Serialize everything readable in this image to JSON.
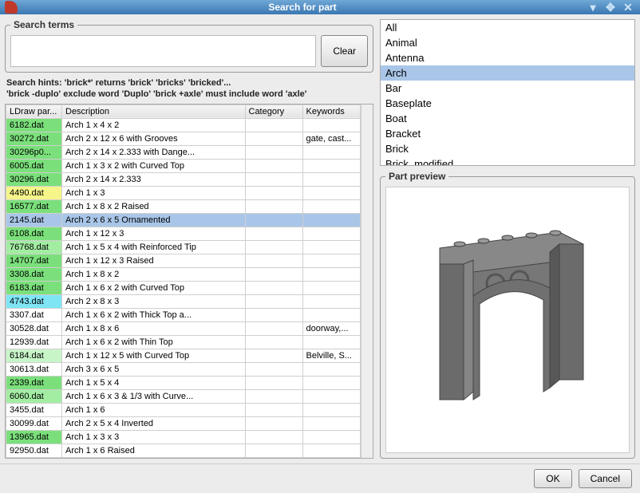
{
  "window": {
    "title": "Search for part"
  },
  "search": {
    "legend": "Search terms",
    "value": "",
    "clear": "Clear"
  },
  "hints": {
    "line1": "Search hints: 'brick*' returns 'brick' 'bricks' 'bricked'...",
    "line2": "'brick -duplo' exclude word 'Duplo' 'brick +axle' must include word 'axle'"
  },
  "table": {
    "headers": [
      "LDraw par...",
      "Description",
      "Category",
      "Keywords"
    ],
    "rows": [
      {
        "f": "6182.dat",
        "d": "Arch  1 x  4 x  2",
        "c": "",
        "k": "",
        "cls": "g1"
      },
      {
        "f": "30272.dat",
        "d": "Arch  2 x 12 x  6 with Grooves",
        "c": "",
        "k": "gate, cast...",
        "cls": "g1"
      },
      {
        "f": "30296p0...",
        "d": "Arch  2 x 14 x  2.333 with Dange...",
        "c": "",
        "k": "",
        "cls": "g1"
      },
      {
        "f": "6005.dat",
        "d": "Arch  1 x  3 x  2 with Curved Top",
        "c": "",
        "k": "",
        "cls": "g1"
      },
      {
        "f": "30296.dat",
        "d": "Arch  2 x 14 x  2.333",
        "c": "",
        "k": "",
        "cls": "g1"
      },
      {
        "f": "4490.dat",
        "d": "Arch  1 x  3",
        "c": "",
        "k": "",
        "cls": "y"
      },
      {
        "f": "16577.dat",
        "d": "Arch  1 x  8 x  2 Raised",
        "c": "",
        "k": "",
        "cls": "g1"
      },
      {
        "f": "2145.dat",
        "d": "Arch  2 x  6 x  5 Ornamented",
        "c": "",
        "k": "",
        "cls": "y",
        "sel": true
      },
      {
        "f": "6108.dat",
        "d": "Arch  1 x 12 x  3",
        "c": "",
        "k": "",
        "cls": "g1"
      },
      {
        "f": "76768.dat",
        "d": "Arch  1 x  5 x  4 with Reinforced Tip",
        "c": "",
        "k": "",
        "cls": "g2"
      },
      {
        "f": "14707.dat",
        "d": "Arch  1 x 12 x  3 Raised",
        "c": "",
        "k": "",
        "cls": "g1"
      },
      {
        "f": "3308.dat",
        "d": "Arch  1 x  8 x  2",
        "c": "",
        "k": "",
        "cls": "g1"
      },
      {
        "f": "6183.dat",
        "d": "Arch  1 x  6 x  2 with Curved Top",
        "c": "",
        "k": "",
        "cls": "g1"
      },
      {
        "f": "4743.dat",
        "d": "Arch  2 x  8 x  3",
        "c": "",
        "k": "",
        "cls": "c"
      },
      {
        "f": "3307.dat",
        "d": "Arch  1 x  6 x  2 with Thick Top a...",
        "c": "",
        "k": "",
        "cls": ""
      },
      {
        "f": "30528.dat",
        "d": "Arch  1 x  8 x  6",
        "c": "",
        "k": "doorway,...",
        "cls": ""
      },
      {
        "f": "12939.dat",
        "d": "Arch  1 x  6 x  2 with Thin Top",
        "c": "",
        "k": "",
        "cls": ""
      },
      {
        "f": "6184.dat",
        "d": "Arch  1 x 12 x  5 with Curved Top",
        "c": "",
        "k": "Belville, S...",
        "cls": "g3"
      },
      {
        "f": "30613.dat",
        "d": "Arch  3 x  6 x  5",
        "c": "",
        "k": "",
        "cls": ""
      },
      {
        "f": "2339.dat",
        "d": "Arch  1 x  5 x  4",
        "c": "",
        "k": "",
        "cls": "g1"
      },
      {
        "f": "6060.dat",
        "d": "Arch  1 x  6 x  3 & 1/3 with Curve...",
        "c": "",
        "k": "",
        "cls": "g2"
      },
      {
        "f": "3455.dat",
        "d": "Arch  1 x  6",
        "c": "",
        "k": "",
        "cls": ""
      },
      {
        "f": "30099.dat",
        "d": "Arch  2 x  5 x  4 Inverted",
        "c": "",
        "k": "",
        "cls": ""
      },
      {
        "f": "13965.dat",
        "d": "Arch  1 x  3 x  3",
        "c": "",
        "k": "",
        "cls": "g1"
      },
      {
        "f": "92950.dat",
        "d": "Arch  1 x  6 Raised",
        "c": "",
        "k": "",
        "cls": ""
      }
    ]
  },
  "categories": {
    "items": [
      "All",
      "Animal",
      "Antenna",
      "Arch",
      "Bar",
      "Baseplate",
      "Boat",
      "Bracket",
      "Brick",
      "Brick, modified"
    ],
    "selected": "Arch"
  },
  "preview": {
    "legend": "Part preview"
  },
  "footer": {
    "ok": "OK",
    "cancel": "Cancel"
  }
}
